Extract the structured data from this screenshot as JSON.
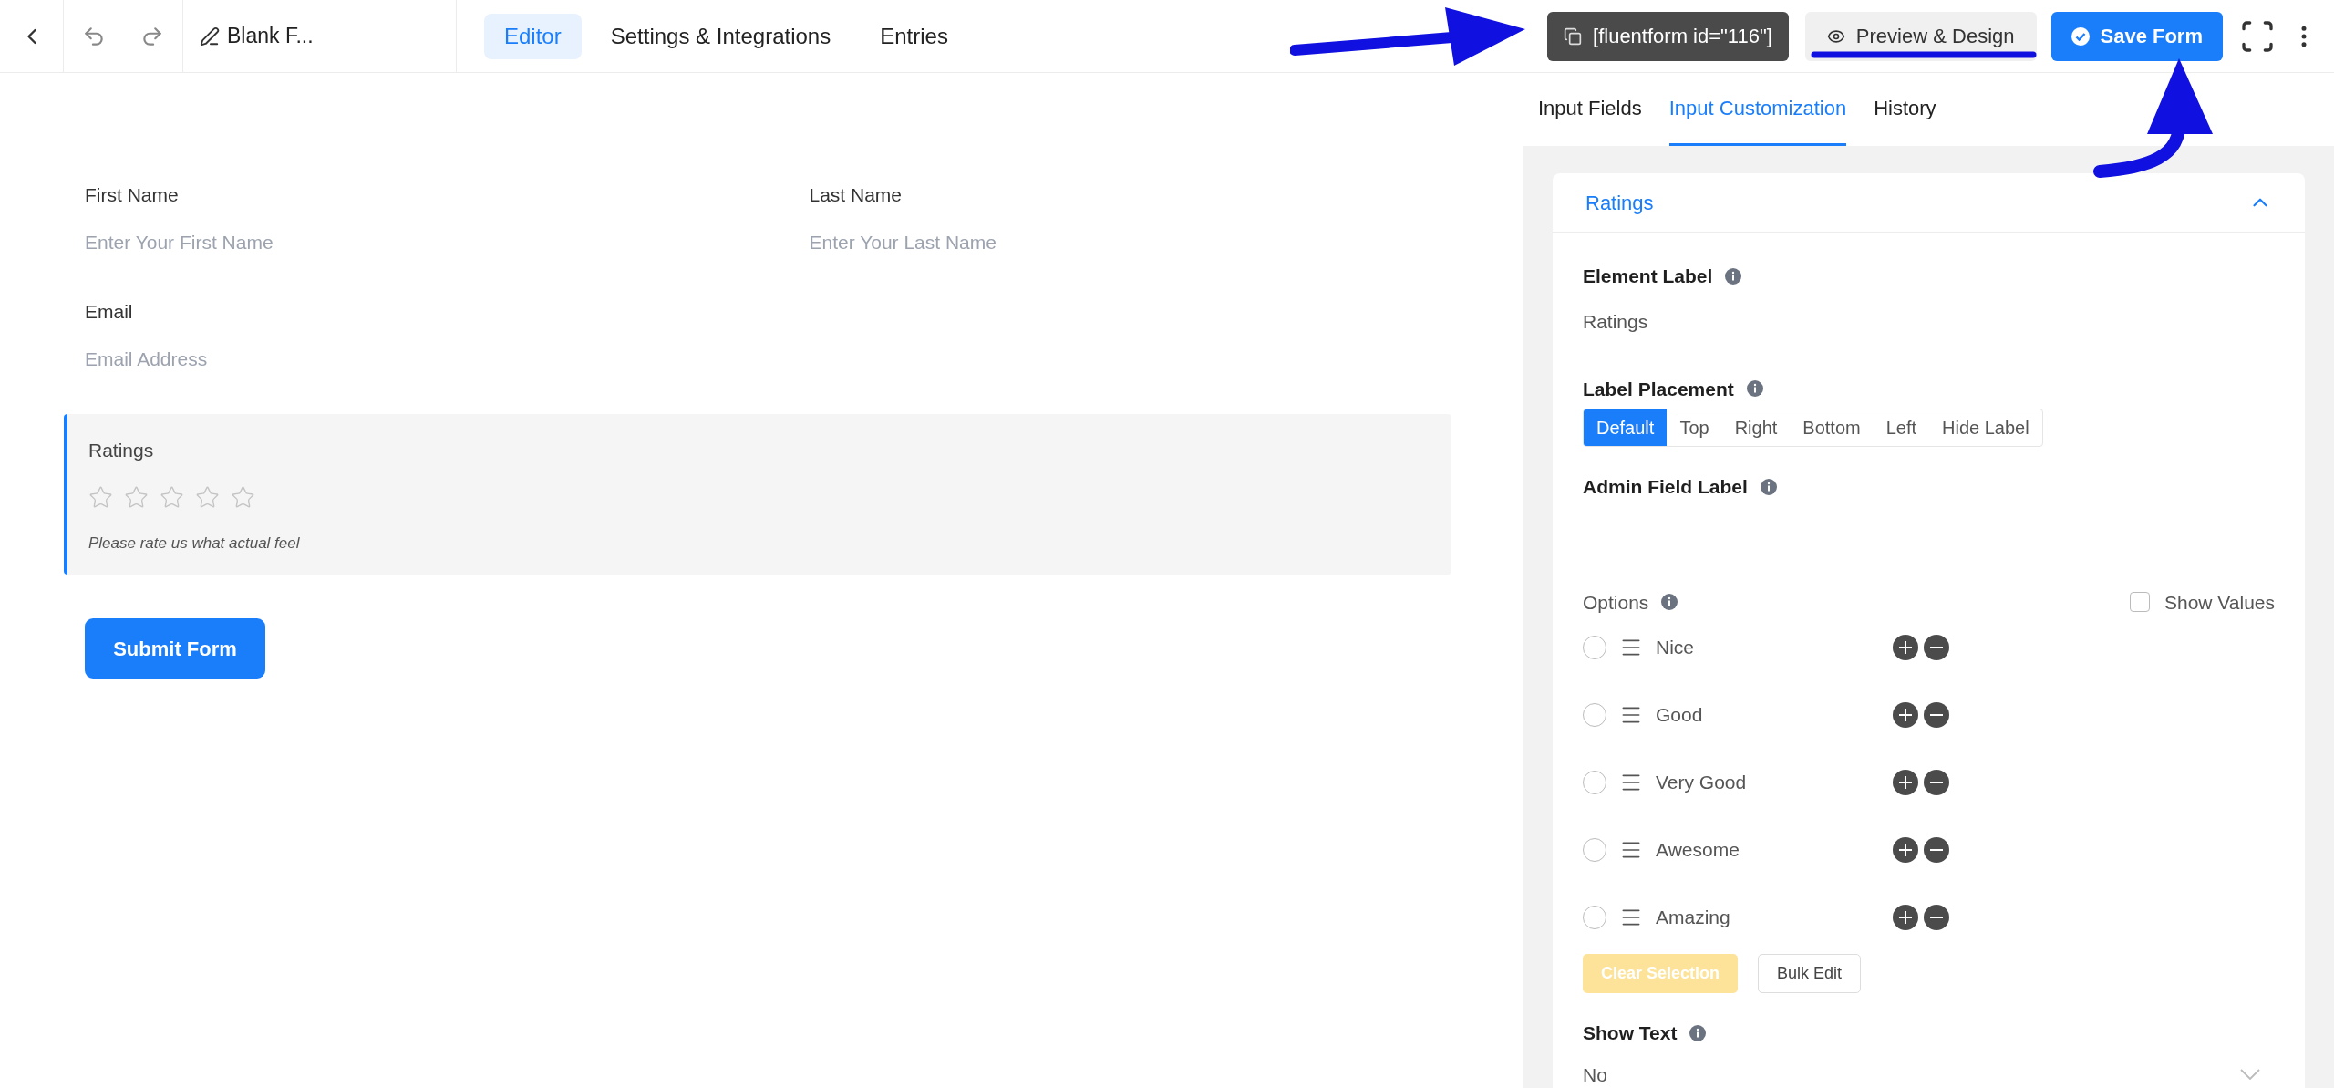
{
  "toolbar": {
    "title": "Blank F...",
    "tabs": [
      {
        "label": "Editor",
        "selected": true
      },
      {
        "label": "Settings & Integrations",
        "selected": false
      },
      {
        "label": "Entries",
        "selected": false
      }
    ],
    "shortcode": "[fluentform id=\"116\"]",
    "preview_button": "Preview & Design",
    "save_button": "Save Form"
  },
  "form": {
    "field_rows": [
      {
        "fields": [
          {
            "label": "First Name",
            "placeholder": "Enter Your First Name"
          },
          {
            "label": "Last Name",
            "placeholder": "Enter Your Last Name"
          }
        ]
      },
      {
        "fields": [
          {
            "label": "Email",
            "placeholder": "Email Address"
          }
        ]
      }
    ],
    "ratings": {
      "label": "Ratings",
      "stars": 0,
      "help": "Please rate us what actual feel",
      "selected": true
    },
    "submit": "Submit Form"
  },
  "panel": {
    "tabs": [
      {
        "label": "Input Fields",
        "selected": false
      },
      {
        "label": "Input Customization",
        "selected": true
      },
      {
        "label": "History",
        "selected": false
      }
    ],
    "section": {
      "title": "Ratings",
      "expanded": true
    },
    "element_label": {
      "label": "Element Label",
      "value": "Ratings"
    },
    "label_placement": {
      "label": "Label Placement",
      "options": [
        {
          "label": "Default",
          "selected": true
        },
        {
          "label": "Top",
          "selected": false
        },
        {
          "label": "Right",
          "selected": false
        },
        {
          "label": "Bottom",
          "selected": false
        },
        {
          "label": "Left",
          "selected": false
        },
        {
          "label": "Hide Label",
          "selected": false
        }
      ]
    },
    "admin_field_label": {
      "label": "Admin Field Label"
    },
    "options": {
      "label": "Options",
      "show_values": {
        "label": "Show Values",
        "checked": false
      },
      "items": [
        {
          "label": "Nice",
          "selected": false
        },
        {
          "label": "Good",
          "selected": false
        },
        {
          "label": "Very Good",
          "selected": false
        },
        {
          "label": "Awesome",
          "selected": false
        },
        {
          "label": "Amazing",
          "selected": false
        }
      ]
    },
    "clear_selection": {
      "label": "Clear Selection",
      "disabled": true
    },
    "bulk_edit": "Bulk Edit",
    "show_text": {
      "label": "Show Text",
      "value": "No"
    }
  }
}
